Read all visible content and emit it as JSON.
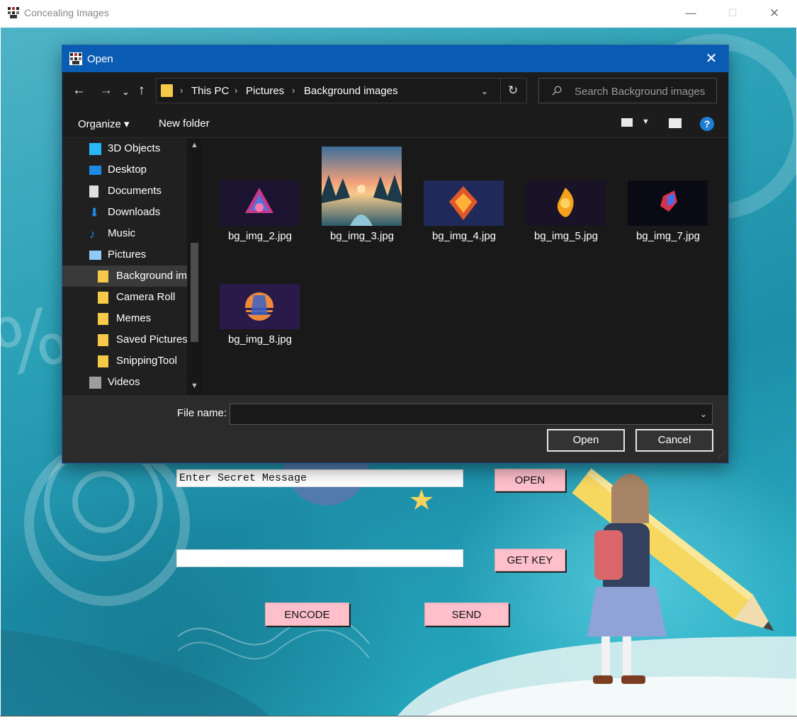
{
  "window": {
    "title": "Concealing Images",
    "controls": {
      "minimize": "—",
      "maximize": "☐",
      "close": "✕"
    }
  },
  "app": {
    "secret_input_value": "Enter Secret Message",
    "key_input_value": "",
    "open_label": "OPEN",
    "get_key_label": "GET KEY",
    "encode_label": "ENCODE",
    "send_label": "SEND",
    "background_glyph": "%"
  },
  "dialog": {
    "title": "Open",
    "close_glyph": "✕",
    "nav": {
      "back": "←",
      "forward": "→",
      "recent": "⌄",
      "up": "↑",
      "refresh": "↻"
    },
    "breadcrumb": [
      "This PC",
      "Pictures",
      "Background images"
    ],
    "breadcrumb_sep": "›",
    "search_placeholder": "Search Background images",
    "toolbar": {
      "organize": "Organize ▾",
      "new_folder": "New folder",
      "help": "?"
    },
    "nav_pane": [
      {
        "label": "3D Objects",
        "icon": "cube-icon",
        "color": "#29b6f6"
      },
      {
        "label": "Desktop",
        "icon": "desktop-icon",
        "color": "#1e88e5"
      },
      {
        "label": "Documents",
        "icon": "document-icon",
        "color": "#e0e0e0"
      },
      {
        "label": "Downloads",
        "icon": "download-arrow-icon",
        "color": "#1e88e5"
      },
      {
        "label": "Music",
        "icon": "music-note-icon",
        "color": "#1e88e5"
      },
      {
        "label": "Pictures",
        "icon": "pictures-icon",
        "color": "#90caf9"
      },
      {
        "label": "Background images",
        "icon": "folder-icon",
        "color": "#f7c948",
        "selected": true
      },
      {
        "label": "Camera Roll",
        "icon": "folder-icon",
        "color": "#f7c948"
      },
      {
        "label": "Memes",
        "icon": "folder-icon",
        "color": "#f7c948"
      },
      {
        "label": "Saved Pictures",
        "icon": "folder-icon",
        "color": "#f7c948"
      },
      {
        "label": "SnippingTool",
        "icon": "folder-icon",
        "color": "#f7c948"
      },
      {
        "label": "Videos",
        "icon": "film-icon",
        "color": "#9e9e9e"
      }
    ],
    "files": [
      {
        "name": "bg_img_2.jpg"
      },
      {
        "name": "bg_img_3.jpg"
      },
      {
        "name": "bg_img_4.jpg"
      },
      {
        "name": "bg_img_5.jpg"
      },
      {
        "name": "bg_img_7.jpg"
      },
      {
        "name": "bg_img_8.jpg"
      }
    ],
    "file_name_label": "File name:",
    "file_name_value": "",
    "open_button": "Open",
    "cancel_button": "Cancel"
  },
  "colors": {
    "dialog_titlebar": "#0a5cb3",
    "dialog_bg": "#202020",
    "app_button": "#ffc0cb",
    "folder": "#f7c948"
  }
}
